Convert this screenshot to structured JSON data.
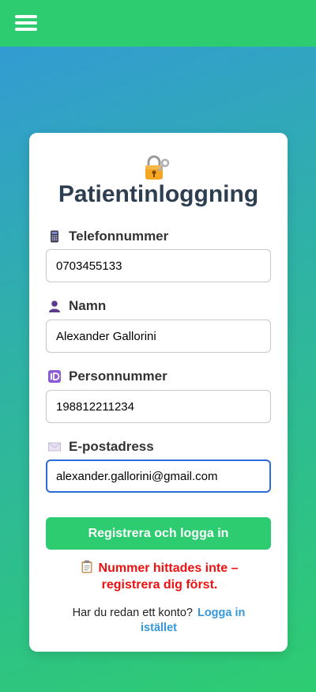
{
  "header": {
    "menu_icon": "hamburger-menu-icon",
    "background_color": "#2ecc71"
  },
  "form": {
    "title": "Patientinloggning",
    "title_icon": "locked-with-key-icon",
    "fields": [
      {
        "label": "Telefonnummer",
        "icon": "mobile-phone-icon",
        "value": "0703455133"
      },
      {
        "label": "Namn",
        "icon": "person-silhouette-icon",
        "value": "Alexander Gallorini"
      },
      {
        "label": "Personnummer",
        "icon": "id-badge-icon",
        "value": "198812211234"
      },
      {
        "label": "E-postadress",
        "icon": "envelope-icon",
        "value": "alexander.gallorini@gmail.com",
        "focused": true
      }
    ],
    "submit_label": "Registrera och logga in",
    "error_icon": "clipboard-icon",
    "error_message": "Nummer hittades inte – registrera dig först.",
    "login_prompt": "Har du redan ett konto?",
    "login_link": "Logga in istället"
  },
  "colors": {
    "accent_green": "#2ecc71",
    "background_blue": "#3398d9",
    "title_color": "#2c3e50",
    "error_red": "#ee1111",
    "link_blue": "#3498db",
    "focus_border": "#2d6cd6"
  }
}
